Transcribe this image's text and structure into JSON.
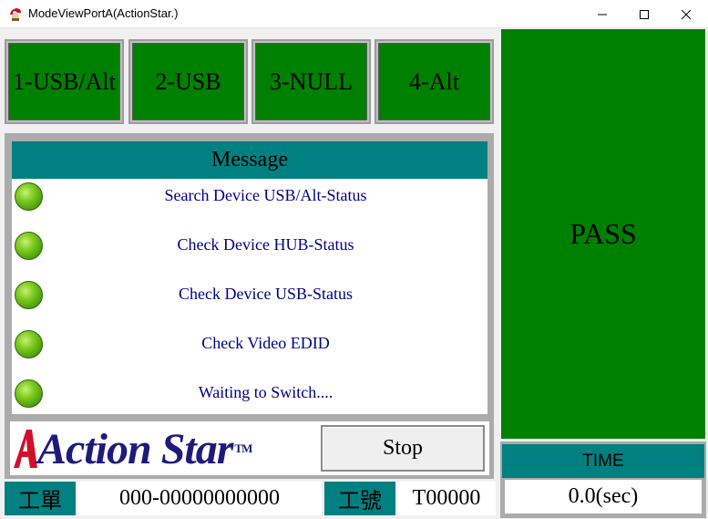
{
  "window": {
    "title": "ModeViewPortA(ActionStar.)",
    "minimize_glyph": "—",
    "maximize_glyph": "☐",
    "close_glyph": "✕"
  },
  "ports": [
    {
      "label": "1-USB/Alt"
    },
    {
      "label": "2-USB"
    },
    {
      "label": "3-NULL"
    },
    {
      "label": "4-Alt"
    }
  ],
  "messages": {
    "header": "Message",
    "lines": [
      {
        "text": "Search Device USB/Alt-Status",
        "status": "ok"
      },
      {
        "text": "Check Device HUB-Status",
        "status": "ok"
      },
      {
        "text": "Check Device USB-Status",
        "status": "ok"
      },
      {
        "text": "Check Video EDID",
        "status": "ok"
      },
      {
        "text": "Waiting to Switch....",
        "status": "ok"
      }
    ]
  },
  "logo": {
    "text": "Action Star",
    "tm": "TM"
  },
  "stop_button": {
    "label": "Stop"
  },
  "bottom": {
    "work_order_label": "工單",
    "work_order_value": "000-00000000000",
    "operator_label": "工號",
    "operator_value": "T00000"
  },
  "result": {
    "text": "PASS"
  },
  "time": {
    "label": "TIME",
    "value": "0.0(sec)"
  },
  "colors": {
    "pass_green": "#008000",
    "teal": "#008080",
    "message_text": "#000080",
    "logo_navy": "#1f1a7a",
    "logo_red": "#d0102a"
  }
}
